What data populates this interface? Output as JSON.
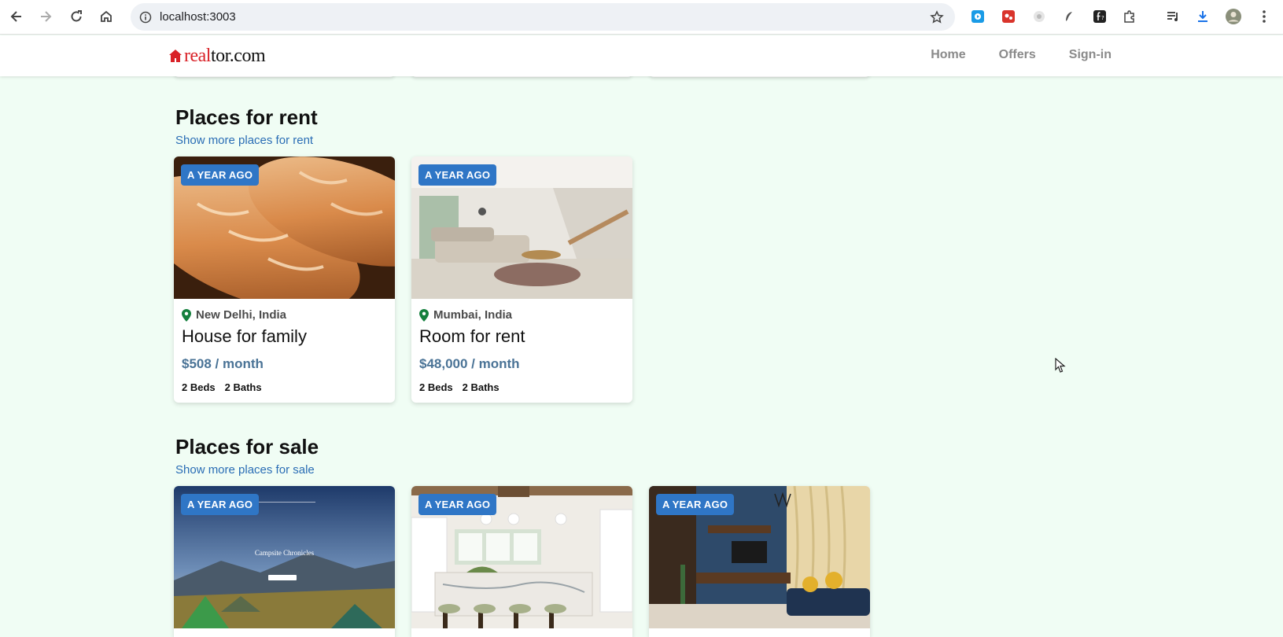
{
  "browser": {
    "url": "localhost:3003"
  },
  "site": {
    "logo_prefix": "real",
    "logo_suffix": "tor.com",
    "nav": [
      "Home",
      "Offers",
      "Sign-in"
    ]
  },
  "rent": {
    "title": "Places for rent",
    "link": "Show more places for rent",
    "cards": [
      {
        "badge": "A YEAR AGO",
        "location": "New Delhi, India",
        "title": "House for family",
        "price": "$508 / month",
        "beds": "2 Beds",
        "baths": "2 Baths"
      },
      {
        "badge": "A YEAR AGO",
        "location": "Mumbai, India",
        "title": "Room for rent",
        "price": "$48,000 / month",
        "beds": "2 Beds",
        "baths": "2 Baths"
      }
    ]
  },
  "sale": {
    "title": "Places for sale",
    "link": "Show more places for sale",
    "cards": [
      {
        "badge": "A YEAR AGO",
        "image_title": "Campsite Chronicles"
      },
      {
        "badge": "A YEAR AGO"
      },
      {
        "badge": "A YEAR AGO"
      }
    ]
  },
  "colors": {
    "background": "#f0fdf4",
    "badge": "#2f76c6",
    "link": "#2a6db5",
    "pin": "#15803d"
  }
}
